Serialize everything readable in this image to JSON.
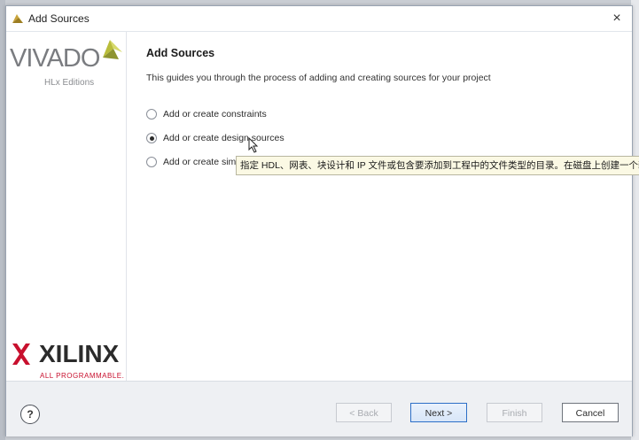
{
  "window": {
    "title": "Add Sources",
    "close_glyph": "×"
  },
  "brand": {
    "vivado": "VIVADO",
    "editions": "HLx Editions",
    "xilinx": "XILINX",
    "tagline": "ALL PROGRAMMABLE."
  },
  "main": {
    "heading": "Add Sources",
    "description": "This guides you through the process of adding and creating sources for your project",
    "options": [
      {
        "label": "Add or create constraints",
        "selected": false
      },
      {
        "label": "Add or create design sources",
        "selected": true
      },
      {
        "label": "Add or create simu",
        "selected": false
      }
    ],
    "tooltip": "指定 HDL、网表、块设计和 IP 文件或包含要添加到工程中的文件类型的目录。在磁盘上创建一个新的"
  },
  "footer": {
    "help": "?",
    "back": "< Back",
    "next": "Next >",
    "finish": "Finish",
    "cancel": "Cancel"
  },
  "colors": {
    "accent": "#2d6fc7",
    "vivado_leaf": "#c8c84a",
    "xilinx_red": "#c8102e"
  },
  "icons": {
    "title": "vivado-leaf-icon",
    "close": "close-icon",
    "help": "help-icon",
    "cursor": "mouse-cursor-icon"
  }
}
